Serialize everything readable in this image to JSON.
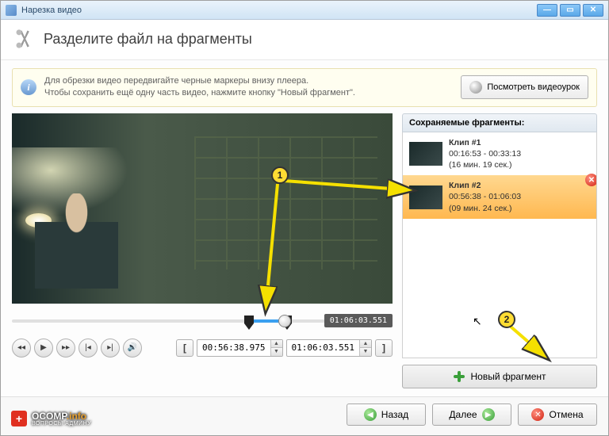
{
  "window": {
    "title": "Нарезка видео"
  },
  "header": {
    "title": "Разделите файл на фрагменты"
  },
  "info": {
    "line1": "Для обрезки видео передвигайте черные маркеры внизу плеера.",
    "line2": "Чтобы сохранить ещё одну часть видео, нажмите кнопку \"Новый фрагмент\".",
    "tutorial_btn": "Посмотреть видеоурок"
  },
  "timeline": {
    "current_time": "01:06:03.551"
  },
  "controls": {
    "start_time": "00:56:38.975",
    "end_time": "01:06:03.551"
  },
  "fragments": {
    "header": "Сохраняемые фрагменты:",
    "items": [
      {
        "name": "Клип #1",
        "range": "00:16:53 - 00:33:13",
        "duration": "(16 мин. 19 сек.)"
      },
      {
        "name": "Клип #2",
        "range": "00:56:38 - 01:06:03",
        "duration": "(09 мин. 24 сек.)"
      }
    ],
    "new_btn": "Новый фрагмент"
  },
  "footer": {
    "back": "Назад",
    "next": "Далее",
    "cancel": "Отмена"
  },
  "annotations": {
    "badge1": "1",
    "badge2": "2"
  },
  "watermark": {
    "brand": "OCOMP",
    "suffix": ".info",
    "sub": "ВОПРОСЫ АДМИНУ"
  }
}
